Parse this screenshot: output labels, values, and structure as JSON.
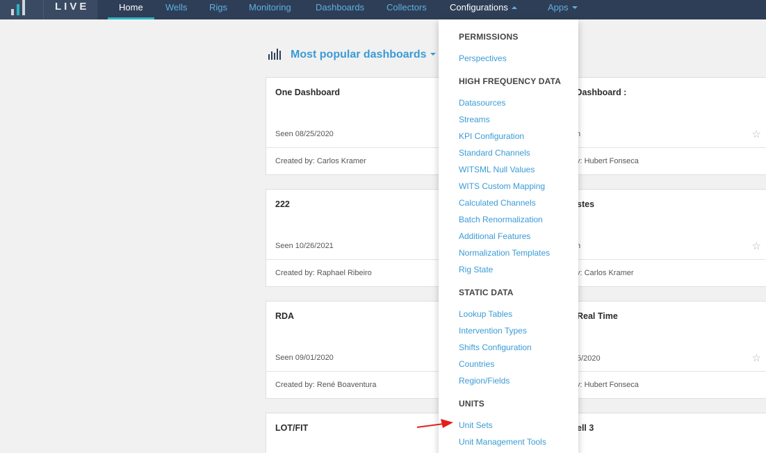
{
  "navbar": {
    "brand": "LIVE",
    "items": [
      {
        "label": "Home"
      },
      {
        "label": "Wells"
      },
      {
        "label": "Rigs"
      },
      {
        "label": "Monitoring"
      },
      {
        "label": "Dashboards"
      },
      {
        "label": "Collectors"
      },
      {
        "label": "Configurations"
      },
      {
        "label": "Apps"
      }
    ]
  },
  "section": {
    "title": "Most popular dashboards",
    "icon": "bar-chart-icon"
  },
  "cards": [
    {
      "title": "One Dashboard",
      "seen": "Seen 08/25/2020",
      "creator": "Created by: Carlos Kramer"
    },
    {
      "title": "s Dashboard :",
      "seen": "n",
      "creator": "y: Hubert Fonseca"
    },
    {
      "title": "222",
      "seen": "Seen 10/26/2021",
      "creator": "Created by: Raphael Ribeiro"
    },
    {
      "title": "stes",
      "seen": "n",
      "creator": "y: Carlos Kramer"
    },
    {
      "title": "RDA",
      "seen": "Seen 09/01/2020",
      "creator": "Created by: René Boaventura"
    },
    {
      "title": "Real Time",
      "seen": "5/2020",
      "creator": "y: Hubert Fonseca"
    },
    {
      "title": "LOT/FIT",
      "seen": "",
      "creator": ""
    },
    {
      "title": "ell 3",
      "seen": "",
      "creator": ""
    }
  ],
  "dropdown": {
    "permissions": {
      "header": "PERMISSIONS",
      "items": [
        "Perspectives"
      ]
    },
    "hfd": {
      "header": "HIGH FREQUENCY DATA",
      "items": [
        "Datasources",
        "Streams",
        "KPI Configuration",
        "Standard Channels",
        "WITSML Null Values",
        "WITS Custom Mapping",
        "Calculated Channels",
        "Batch Renormalization",
        "Additional Features",
        "Normalization Templates",
        "Rig State"
      ]
    },
    "static": {
      "header": "STATIC DATA",
      "items": [
        "Lookup Tables",
        "Intervention Types",
        "Shifts Configuration",
        "Countries",
        "Region/Fields"
      ]
    },
    "units": {
      "header": "UNITS",
      "items": [
        "Unit Sets",
        "Unit Management Tools"
      ]
    }
  },
  "colors": {
    "navbar": "#2e3e56",
    "accent": "#2bb3c0",
    "link": "#3a9bd5",
    "arrow": "#e0201b"
  }
}
